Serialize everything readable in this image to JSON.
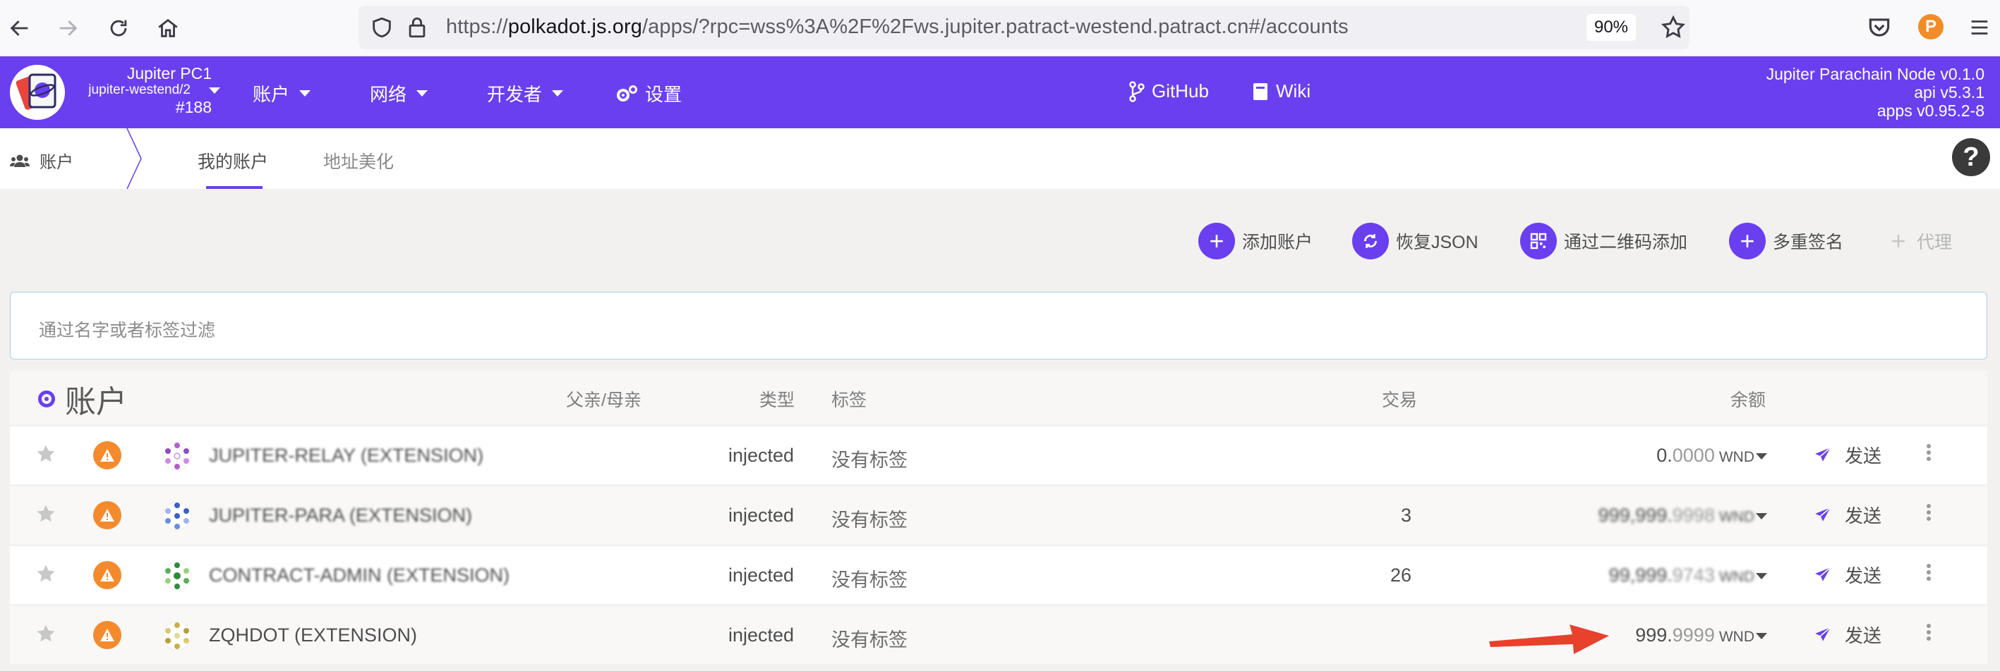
{
  "browser": {
    "url_prefix": "https://",
    "url_domain": "polkadot.js.org",
    "url_rest": "/apps/?rpc=wss%3A%2F%2Fws.jupiter.patract-westend.patract.cn#/accounts",
    "zoom": "90%"
  },
  "header": {
    "chain_name": "Jupiter PC1",
    "chain_sub": "jupiter-westend/2",
    "block": "#188",
    "menu": {
      "accounts": "账户",
      "network": "网络",
      "developer": "开发者",
      "settings": "设置",
      "github": "GitHub",
      "wiki": "Wiki"
    },
    "node": {
      "line1": "Jupiter Parachain Node v0.1.0",
      "line2": "api v5.3.1",
      "line3": "apps v0.95.2-8"
    },
    "brand_color": "#6a3ff0"
  },
  "subnav": {
    "section": "账户",
    "tabs": [
      "我的账户",
      "地址美化"
    ]
  },
  "actions": {
    "add_account": "添加账户",
    "restore_json": "恢复JSON",
    "add_via_qr": "通过二维码添加",
    "multisig": "多重签名",
    "proxy": "代理"
  },
  "filter": {
    "placeholder": "通过名字或者标签过滤"
  },
  "table": {
    "title": "账户",
    "headers": {
      "parent": "父亲/母亲",
      "type": "类型",
      "tags": "标签",
      "transactions": "交易",
      "balance": "余额"
    },
    "rows": [
      {
        "name": "JUPITER-RELAY (EXTENSION)",
        "type": "injected",
        "tags": "没有标签",
        "tx": "",
        "balance_int": "0.",
        "balance_frac": "0000",
        "unit": "WND",
        "send": "发送"
      },
      {
        "name": "JUPITER-PARA (EXTENSION)",
        "type": "injected",
        "tags": "没有标签",
        "tx": "3",
        "balance_int": "999,999.",
        "balance_frac": "9998",
        "unit": "WND",
        "send": "发送"
      },
      {
        "name": "CONTRACT-ADMIN (EXTENSION)",
        "type": "injected",
        "tags": "没有标签",
        "tx": "26",
        "balance_int": "99,999.",
        "balance_frac": "9743",
        "unit": "WND",
        "send": "发送"
      },
      {
        "name": "ZQHDOT (EXTENSION)",
        "type": "injected",
        "tags": "没有标签",
        "tx": "",
        "balance_int": "999.",
        "balance_frac": "9999",
        "unit": "WND",
        "send": "发送"
      }
    ]
  }
}
